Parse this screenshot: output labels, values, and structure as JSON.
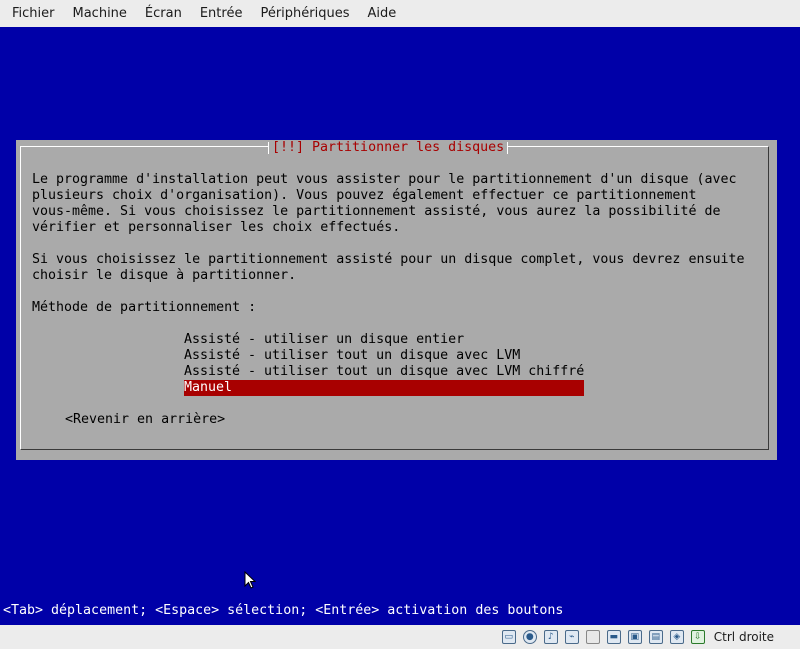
{
  "menubar": {
    "items": [
      "Fichier",
      "Machine",
      "Écran",
      "Entrée",
      "Périphériques",
      "Aide"
    ]
  },
  "dialog": {
    "title": "[!!] Partitionner les disques",
    "paragraph1": [
      "Le programme d'installation peut vous assister pour le partitionnement d'un disque (avec",
      "plusieurs choix d'organisation). Vous pouvez également effectuer ce partitionnement",
      "vous-même. Si vous choisissez le partitionnement assisté, vous aurez la possibilité de",
      "vérifier et personnaliser les choix effectués."
    ],
    "paragraph2": [
      "Si vous choisissez le partitionnement assisté pour un disque complet, vous devrez ensuite",
      "choisir le disque à partitionner."
    ],
    "method_label": "Méthode de partitionnement :",
    "options": [
      "Assisté - utiliser un disque entier",
      "Assisté - utiliser tout un disque avec LVM",
      "Assisté - utiliser tout un disque avec LVM chiffré",
      "Manuel"
    ],
    "selected_option": "Manuel",
    "back_button": "<Revenir en arrière>"
  },
  "hint_line": "<Tab> déplacement; <Espace> sélection; <Entrée> activation des boutons",
  "statusbar": {
    "icons": [
      "hard-disk-icon",
      "optical-drive-icon",
      "audio-icon",
      "usb-icon",
      "shared-folder-icon",
      "display-icon",
      "video-capture-icon",
      "cpu-icon",
      "network-icon",
      "mouse-integration-icon"
    ],
    "host_key": "Ctrl droite"
  },
  "colors": {
    "screen_background": "#0000a8",
    "dialog_background": "#aaaaaa",
    "accent_red": "#a80000"
  }
}
